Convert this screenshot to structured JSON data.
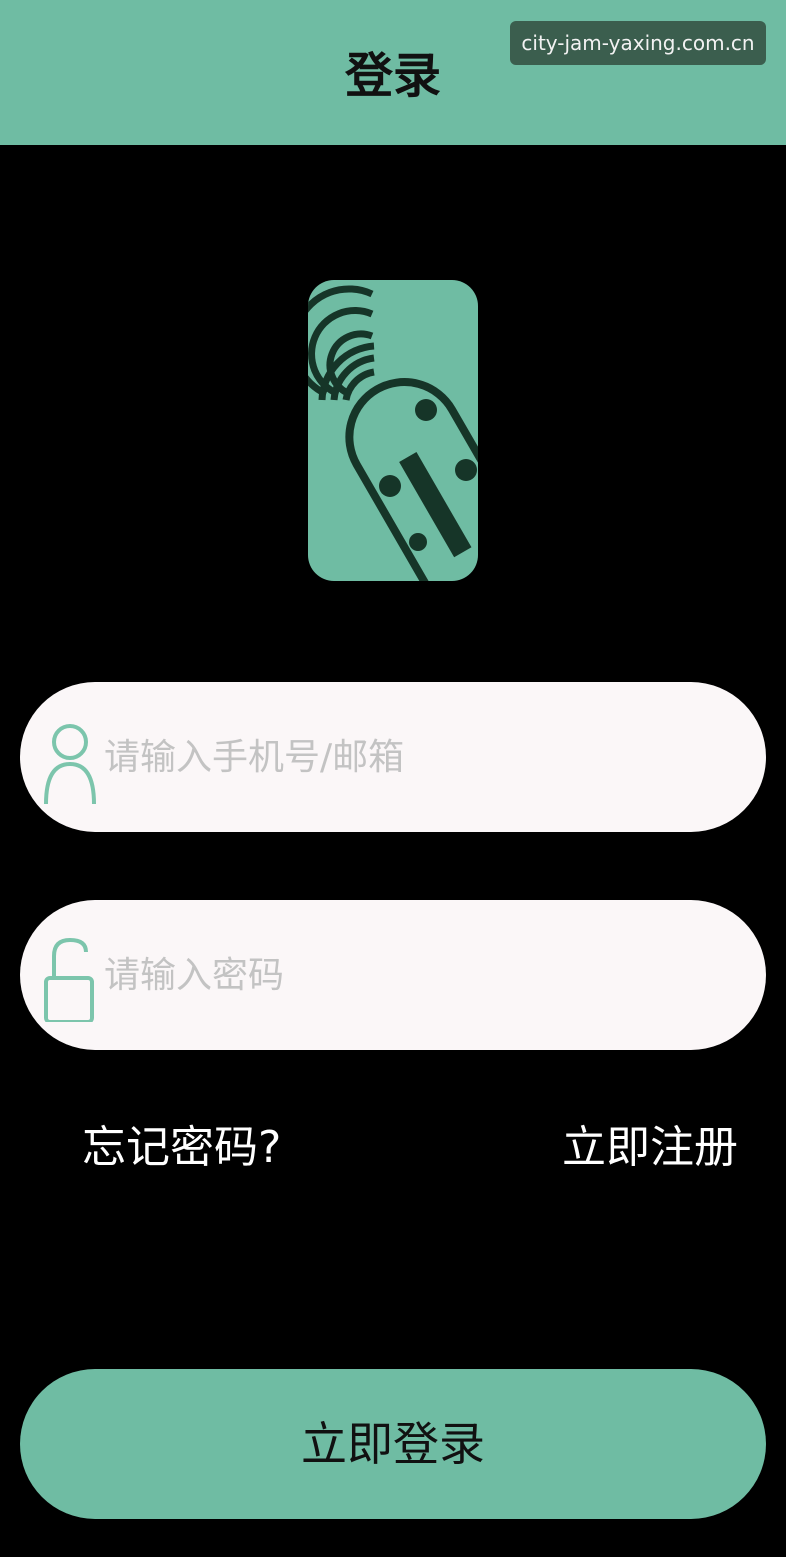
{
  "header": {
    "title": "登录"
  },
  "watermark": {
    "text": "city-jam-yaxing.com.cn"
  },
  "logo": {
    "icon": "wifi-card-icon"
  },
  "form": {
    "account": {
      "icon": "user-icon",
      "placeholder": "请输入手机号/邮箱",
      "value": ""
    },
    "password": {
      "icon": "unlock-icon",
      "placeholder": "请输入密码",
      "value": ""
    }
  },
  "links": {
    "forgot_password": "忘记密码?",
    "register": "立即注册"
  },
  "actions": {
    "login_label": "立即登录"
  },
  "colors": {
    "accent": "#6fbca3",
    "background": "#000000",
    "field_background": "#fbf7f8",
    "icon_dark": "#163528"
  }
}
